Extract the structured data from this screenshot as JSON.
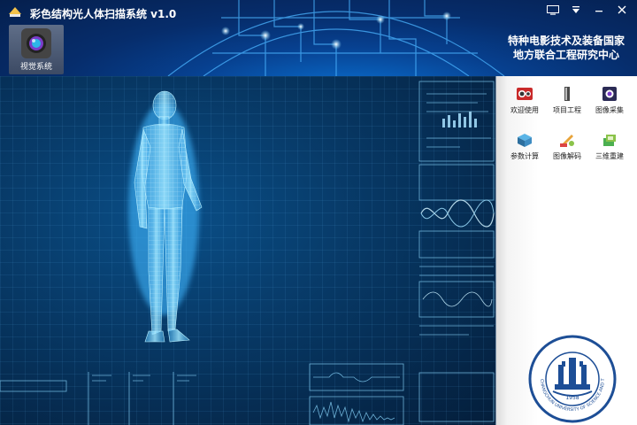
{
  "app": {
    "title": "彩色结构光人体扫描系统 v1.0",
    "org_line1": "特种电影技术及装备国家",
    "org_line2": "地方联合工程研究中心"
  },
  "nav": {
    "vision_label": "视觉系统"
  },
  "panel": {
    "functions": [
      {
        "label": "欢迎使用",
        "icon": "welcome-icon"
      },
      {
        "label": "项目工程",
        "icon": "project-icon"
      },
      {
        "label": "图像采集",
        "icon": "camera-capture-icon"
      },
      {
        "label": "参数计算",
        "icon": "parameter-calc-icon"
      },
      {
        "label": "图像解码",
        "icon": "image-decode-icon"
      },
      {
        "label": "三维重建",
        "icon": "reconstruction-icon"
      }
    ]
  },
  "seal": {
    "university": "CHANGCHUN UNIVERSITY OF SCIENCE AND TECHNOLOGY",
    "year": "1958"
  },
  "colors": {
    "accent": "#1e90ff",
    "hologram": "#7fd8ff"
  }
}
